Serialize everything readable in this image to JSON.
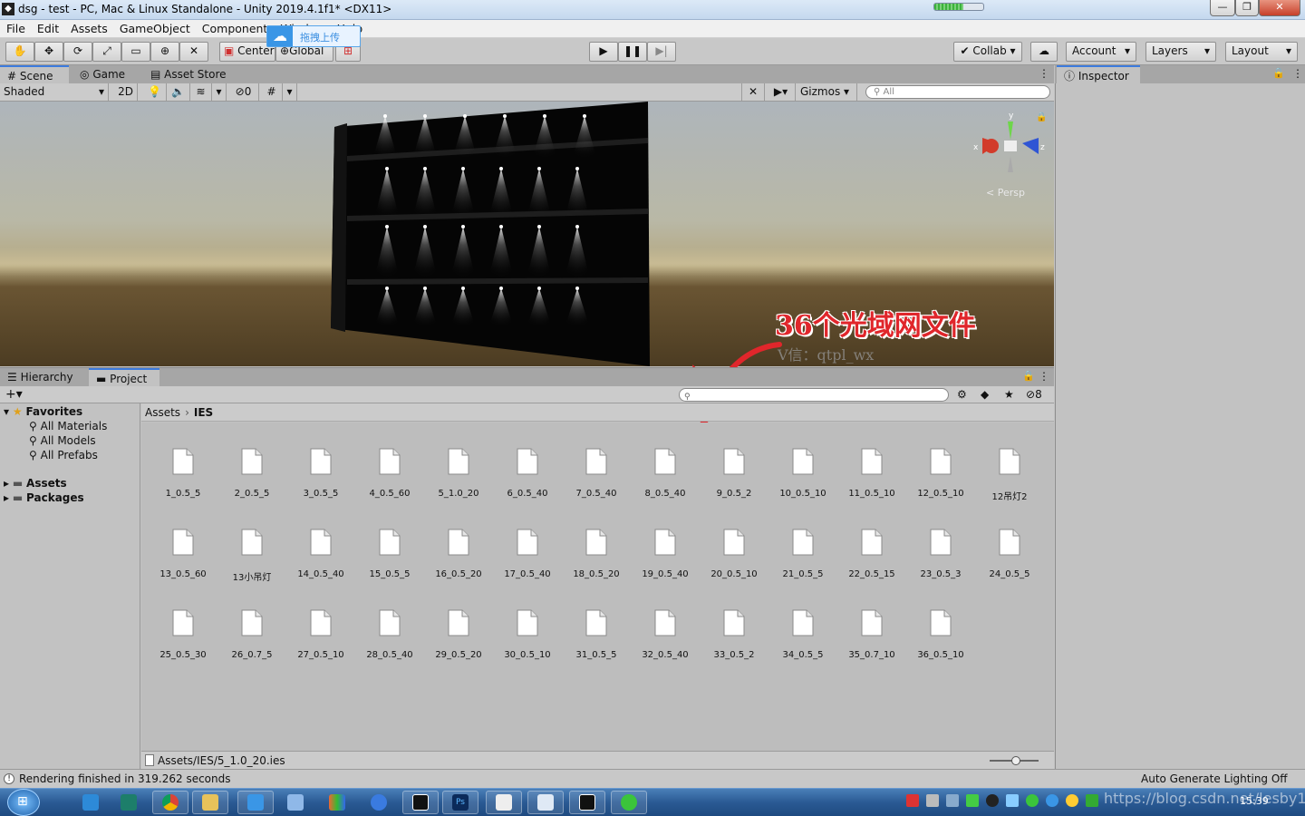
{
  "window": {
    "title": "dsg - test - PC, Mac & Linux Standalone - Unity 2019.4.1f1* <DX11>",
    "icon": "unity-icon",
    "controls": [
      "—",
      "❐",
      "✕"
    ]
  },
  "menu": [
    "File",
    "Edit",
    "Assets",
    "GameObject",
    "Component",
    "Window",
    "Help"
  ],
  "upload_overlay": {
    "label": "拖拽上传",
    "icon": "baidu-cloud-icon"
  },
  "toolbar": {
    "tools": [
      "hand-icon",
      "move-icon",
      "rotate-icon",
      "scale-icon",
      "rect-icon",
      "transform-icon",
      "custom-tool-icon"
    ],
    "pivot": "Center",
    "space": "Global",
    "collab": "Collab",
    "account": "Account",
    "layers": "Layers",
    "layout": "Layout"
  },
  "tabs": {
    "scene": "Scene",
    "game": "Game",
    "asset_store": "Asset Store",
    "inspector": "Inspector",
    "hierarchy": "Hierarchy",
    "project": "Project"
  },
  "scene_toolbar": {
    "shading": "Shaded",
    "mode_2d": "2D",
    "hidden_count": "0",
    "gizmos": "Gizmos",
    "search_placeholder": "All"
  },
  "scene": {
    "view_label": "Persp",
    "annotation": "36个光域网文件",
    "watermark": "V信：qtpl_wx",
    "axis_labels": {
      "x": "x",
      "y": "y",
      "z": "z"
    }
  },
  "project": {
    "hidden_count": "8",
    "favorites_label": "Favorites",
    "favorites": [
      "All Materials",
      "All Models",
      "All Prefabs"
    ],
    "roots": [
      "Assets",
      "Packages"
    ],
    "breadcrumb": [
      "Assets",
      "IES"
    ],
    "files": [
      "1_0.5_5",
      "2_0.5_5",
      "3_0.5_5",
      "4_0.5_60",
      "5_1.0_20",
      "6_0.5_40",
      "7_0.5_40",
      "8_0.5_40",
      "9_0.5_2",
      "10_0.5_10",
      "11_0.5_10",
      "12_0.5_10",
      "12吊灯2",
      "13_0.5_60",
      "13小吊灯",
      "14_0.5_40",
      "15_0.5_5",
      "16_0.5_20",
      "17_0.5_40",
      "18_0.5_20",
      "19_0.5_40",
      "20_0.5_10",
      "21_0.5_5",
      "22_0.5_15",
      "23_0.5_3",
      "24_0.5_5",
      "25_0.5_30",
      "26_0.7_5",
      "27_0.5_10",
      "28_0.5_40",
      "29_0.5_20",
      "30_0.5_10",
      "31_0.5_5",
      "32_0.5_40",
      "33_0.5_2",
      "34_0.5_5",
      "35_0.7_10",
      "36_0.5_10"
    ],
    "selected_path": "Assets/IES/5_1.0_20.ies"
  },
  "status": {
    "message": "Rendering finished in 319.262 seconds",
    "right": "Auto Generate Lighting Off"
  },
  "taskbar": {
    "time": "15:39",
    "watermark": "https://blog.csdn.net/lesby100"
  }
}
